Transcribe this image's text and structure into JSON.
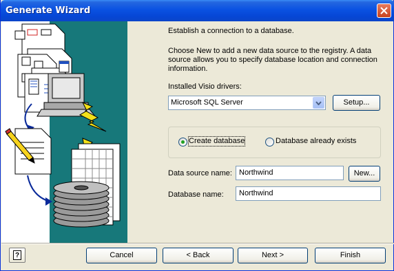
{
  "window": {
    "title": "Generate Wizard"
  },
  "intro": {
    "line1": "Establish a connection to a database.",
    "line2": "Choose New to add a new data source to the registry. A data",
    "line3": "source allows you to specify database location and connection",
    "line4": "information."
  },
  "drivers": {
    "label": "Installed Visio drivers:",
    "selected": "Microsoft SQL Server",
    "setup_label": "Setup..."
  },
  "options": {
    "create_label": "Create database",
    "exists_label": "Database already exists",
    "selected": "create"
  },
  "fields": {
    "data_source_label": "Data source name:",
    "data_source_value": "Northwind",
    "new_label": "New...",
    "database_label": "Database name:",
    "database_value": "Northwind"
  },
  "footer": {
    "help_glyph": "?",
    "cancel_label": "Cancel",
    "back_label": "< Back",
    "next_label": "Next >",
    "finish_label": "Finish"
  },
  "icons": [
    "close-icon",
    "dropdown-arrow-icon",
    "help-icon",
    "wizard-illustration"
  ]
}
